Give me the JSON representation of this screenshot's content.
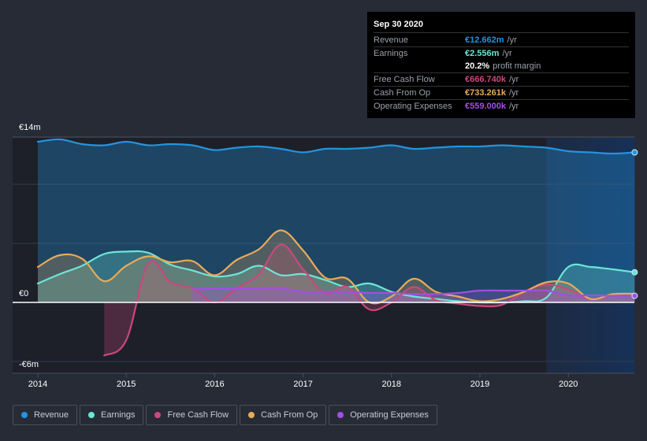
{
  "tooltip": {
    "date": "Sep 30 2020",
    "rows": [
      {
        "label": "Revenue",
        "value": "€12.662m",
        "unit": "/yr",
        "color": "#2394df"
      },
      {
        "label": "Earnings",
        "value": "€2.556m",
        "unit": "/yr",
        "color": "#6ce5d6"
      },
      {
        "label": "",
        "value": "20.2%",
        "unit": "profit margin",
        "color": "#ffffff"
      },
      {
        "label": "Free Cash Flow",
        "value": "€666.740k",
        "unit": "/yr",
        "color": "#c9487e"
      },
      {
        "label": "Cash From Op",
        "value": "€733.261k",
        "unit": "/yr",
        "color": "#e7ab5a"
      },
      {
        "label": "Operating Expenses",
        "value": "€559.000k",
        "unit": "/yr",
        "color": "#a34ee3"
      }
    ]
  },
  "legend": [
    {
      "label": "Revenue",
      "color": "#2394df"
    },
    {
      "label": "Earnings",
      "color": "#6ce5d6"
    },
    {
      "label": "Free Cash Flow",
      "color": "#c9487e"
    },
    {
      "label": "Cash From Op",
      "color": "#e7ab5a"
    },
    {
      "label": "Operating Expenses",
      "color": "#a34ee3"
    }
  ],
  "chart_data": {
    "type": "area",
    "title": "",
    "xlabel": "",
    "ylabel": "",
    "unit": "€m",
    "y_tick_labels": [
      "€14m",
      "€0",
      "-€6m"
    ],
    "ylim": [
      -6,
      14
    ],
    "xlim": [
      2014.0,
      2020.75
    ],
    "x_tick_labels": [
      "2014",
      "2015",
      "2016",
      "2017",
      "2018",
      "2019",
      "2020"
    ],
    "x_ticks": [
      2014,
      2015,
      2016,
      2017,
      2018,
      2019,
      2020
    ],
    "gridlines": [
      14,
      10,
      5,
      0,
      -5
    ],
    "grid": true,
    "forecast_shade_from": 2019.75,
    "series": [
      {
        "name": "Revenue",
        "color": "#2394df",
        "x": [
          2014.0,
          2014.25,
          2014.5,
          2014.75,
          2015.0,
          2015.25,
          2015.5,
          2015.75,
          2016.0,
          2016.25,
          2016.5,
          2016.75,
          2017.0,
          2017.25,
          2017.5,
          2017.75,
          2018.0,
          2018.25,
          2018.5,
          2018.75,
          2019.0,
          2019.25,
          2019.5,
          2019.75,
          2020.0,
          2020.25,
          2020.5,
          2020.75
        ],
        "values": [
          13.6,
          13.8,
          13.4,
          13.3,
          13.6,
          13.3,
          13.4,
          13.3,
          12.9,
          13.1,
          13.2,
          13.0,
          12.7,
          13.0,
          13.0,
          13.1,
          13.3,
          13.0,
          13.1,
          13.2,
          13.2,
          13.3,
          13.2,
          13.1,
          12.8,
          12.7,
          12.6,
          12.7
        ]
      },
      {
        "name": "Earnings",
        "color": "#6ce5d6",
        "x": [
          2014.0,
          2014.25,
          2014.5,
          2014.75,
          2015.0,
          2015.25,
          2015.5,
          2015.75,
          2016.0,
          2016.25,
          2016.5,
          2016.75,
          2017.0,
          2017.25,
          2017.5,
          2017.75,
          2018.0,
          2018.25,
          2018.5,
          2018.75,
          2019.0,
          2019.25,
          2019.5,
          2019.75,
          2020.0,
          2020.25,
          2020.5,
          2020.75
        ],
        "values": [
          1.6,
          2.4,
          3.1,
          4.1,
          4.3,
          4.2,
          3.2,
          2.7,
          2.2,
          2.4,
          3.1,
          2.3,
          2.4,
          1.9,
          1.3,
          1.6,
          0.9,
          0.5,
          0.3,
          0.1,
          0.0,
          0.0,
          0.1,
          0.4,
          3.0,
          3.0,
          2.8,
          2.556
        ]
      },
      {
        "name": "Free Cash Flow",
        "color": "#c9487e",
        "x": [
          2014.75,
          2015.0,
          2015.25,
          2015.5,
          2015.75,
          2016.0,
          2016.25,
          2016.5,
          2016.75,
          2017.0,
          2017.25,
          2017.5,
          2017.75,
          2018.0,
          2018.25,
          2018.5,
          2018.75,
          2019.0,
          2019.25,
          2019.5,
          2019.75,
          2020.0,
          2020.25,
          2020.5,
          2020.75
        ],
        "values": [
          -4.5,
          -3.2,
          3.3,
          1.7,
          1.2,
          0.0,
          1.2,
          2.4,
          4.9,
          2.8,
          0.8,
          1.3,
          -0.6,
          0.0,
          1.3,
          0.2,
          -0.1,
          -0.3,
          -0.2,
          0.9,
          1.5,
          1.1,
          0.3,
          0.6,
          0.667
        ]
      },
      {
        "name": "Cash From Op",
        "color": "#e7ab5a",
        "x": [
          2014.0,
          2014.25,
          2014.5,
          2014.75,
          2015.0,
          2015.25,
          2015.5,
          2015.75,
          2016.0,
          2016.25,
          2016.5,
          2016.75,
          2017.0,
          2017.25,
          2017.5,
          2017.75,
          2018.0,
          2018.25,
          2018.5,
          2018.75,
          2019.0,
          2019.25,
          2019.5,
          2019.75,
          2020.0,
          2020.25,
          2020.5,
          2020.75
        ],
        "values": [
          3.0,
          4.0,
          3.7,
          1.8,
          3.1,
          3.9,
          3.4,
          3.5,
          2.3,
          3.6,
          4.5,
          6.1,
          4.4,
          2.1,
          2.0,
          0.0,
          0.5,
          2.0,
          0.9,
          0.5,
          0.1,
          0.3,
          0.9,
          1.7,
          1.6,
          0.3,
          0.7,
          0.733
        ]
      },
      {
        "name": "Operating Expenses",
        "color": "#a34ee3",
        "x": [
          2015.75,
          2016.0,
          2016.25,
          2016.5,
          2016.75,
          2017.0,
          2017.25,
          2017.5,
          2017.75,
          2018.0,
          2018.25,
          2018.5,
          2018.75,
          2019.0,
          2019.25,
          2019.5,
          2019.75,
          2020.0,
          2020.25,
          2020.5,
          2020.75
        ],
        "values": [
          1.1,
          1.2,
          1.2,
          1.2,
          1.2,
          0.9,
          0.9,
          0.9,
          0.8,
          0.8,
          0.7,
          0.7,
          0.8,
          1.0,
          1.0,
          1.0,
          1.0,
          0.6,
          0.6,
          0.56,
          0.559
        ]
      }
    ]
  }
}
